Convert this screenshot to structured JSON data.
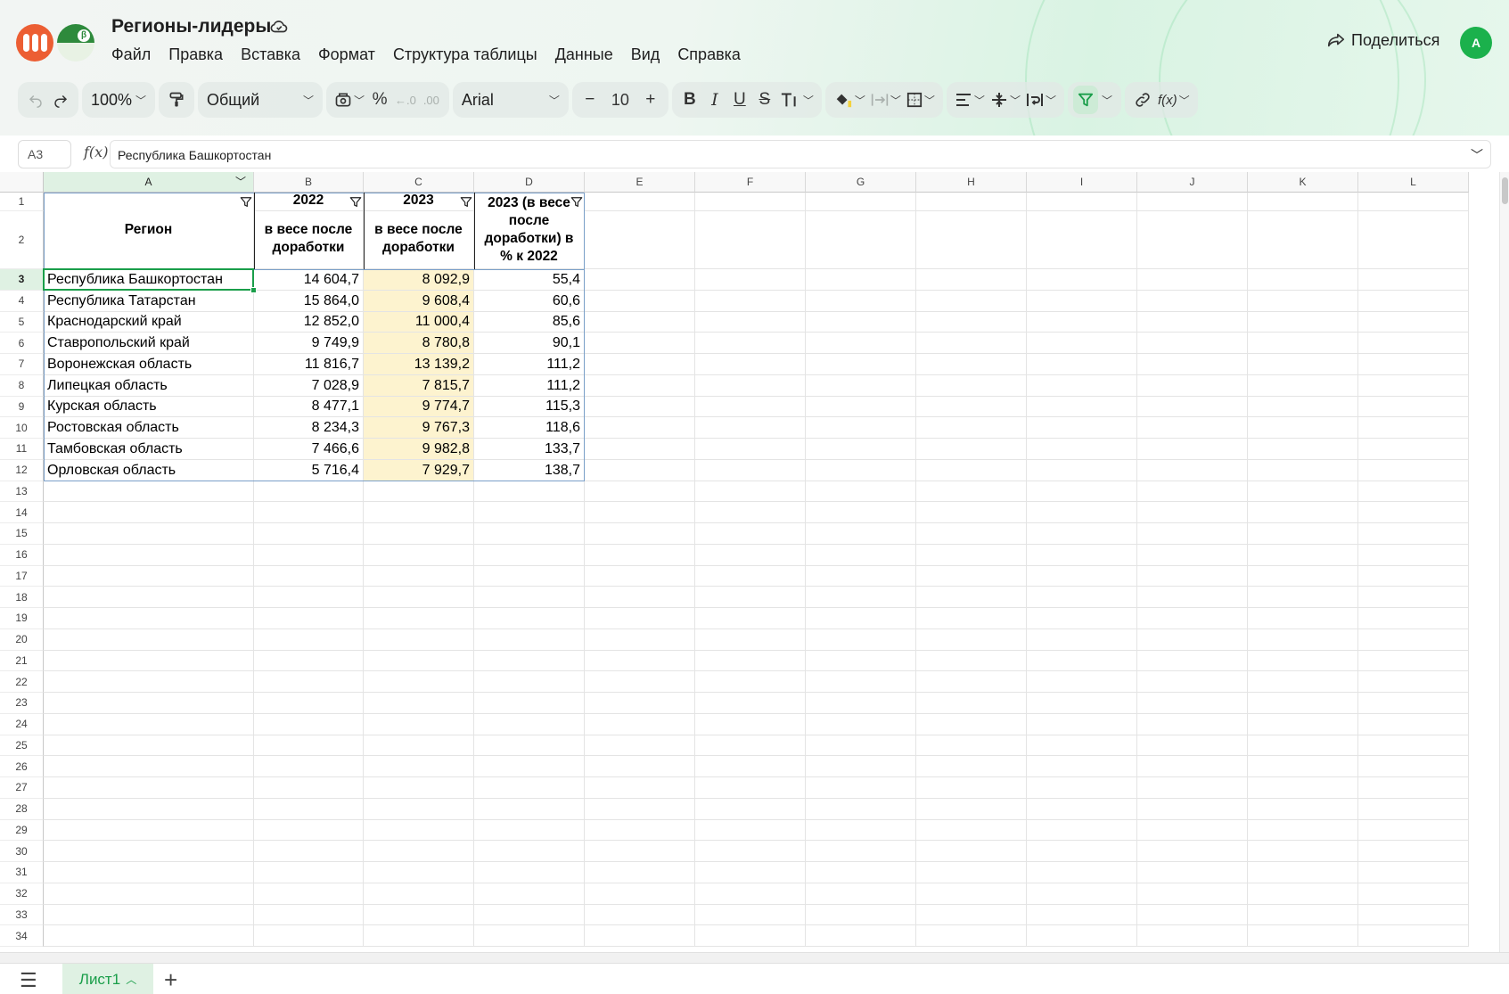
{
  "header": {
    "title": "Регионы-лидеры",
    "menu": [
      "Файл",
      "Правка",
      "Вставка",
      "Формат",
      "Структура таблицы",
      "Данные",
      "Вид",
      "Справка"
    ],
    "share_label": "Поделиться",
    "avatar_initial": "А"
  },
  "toolbar": {
    "zoom": "100%",
    "number_format": "Общий",
    "percent": "%",
    "font_family": "Arial",
    "font_size": "10",
    "bold": "B",
    "italic": "I",
    "underline": "U",
    "strike": "S"
  },
  "formula_bar": {
    "cell_ref": "A3",
    "fx": "f(x)",
    "value": "Республика Башкортостан"
  },
  "grid": {
    "columns": [
      "A",
      "B",
      "C",
      "D",
      "E",
      "F",
      "G",
      "H",
      "I",
      "J",
      "K",
      "L"
    ],
    "selected_column": "A",
    "selected_row": 3,
    "row_count": 34,
    "header_row1": {
      "A": "",
      "B": "2022",
      "C": "2023",
      "D": "2023 (в весе после доработки)  в % к 2022"
    },
    "header_row2": {
      "A": "Регион",
      "B": "в весе после доработки",
      "C": "в весе после доработки"
    },
    "rows": [
      {
        "region": "Республика Башкортостан",
        "v2022": "14 604,7",
        "v2023": "8 092,9",
        "pct": "55,4"
      },
      {
        "region": "Республика Татарстан",
        "v2022": "15 864,0",
        "v2023": "9 608,4",
        "pct": "60,6"
      },
      {
        "region": "Краснодарский край",
        "v2022": "12 852,0",
        "v2023": "11 000,4",
        "pct": "85,6"
      },
      {
        "region": "Ставропольский край",
        "v2022": "9 749,9",
        "v2023": "8 780,8",
        "pct": "90,1"
      },
      {
        "region": "Воронежская область",
        "v2022": "11 816,7",
        "v2023": "13 139,2",
        "pct": "111,2"
      },
      {
        "region": "Липецкая область",
        "v2022": "7 028,9",
        "v2023": "7 815,7",
        "pct": "111,2"
      },
      {
        "region": "Курская область",
        "v2022": "8 477,1",
        "v2023": "9 774,7",
        "pct": "115,3"
      },
      {
        "region": "Ростовская область",
        "v2022": "8 234,3",
        "v2023": "9 767,3",
        "pct": "118,6"
      },
      {
        "region": "Тамбовская область",
        "v2022": "7 466,6",
        "v2023": "9 982,8",
        "pct": "133,7"
      },
      {
        "region": "Орловская область",
        "v2022": "5 716,4",
        "v2023": "7 929,7",
        "pct": "138,7"
      }
    ]
  },
  "sheets": {
    "tabs": [
      "Лист1"
    ],
    "active": "Лист1"
  },
  "colors": {
    "accent": "#1a9e4a",
    "highlight_fill": "#fdf3cf",
    "brand_orange": "#ec5e33"
  }
}
